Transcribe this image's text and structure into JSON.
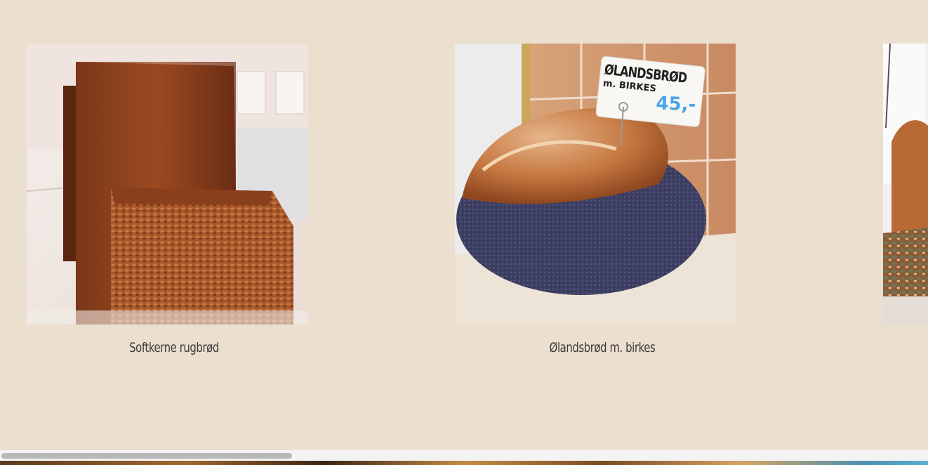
{
  "gallery": {
    "items": [
      {
        "caption": "Softkerne rugbrød",
        "image": "rye-bread-loaf-photo"
      },
      {
        "caption": "Ølandsbrød m. birkes",
        "image": "poppy-seed-bread-photo",
        "sign": {
          "line1": "ØLANDSBRØD",
          "line2": "m. BIRKES",
          "price": "45,-"
        }
      },
      {
        "caption": "",
        "image": "seeded-bread-photo-partial"
      }
    ]
  },
  "scrollbar": {
    "thumb_fraction": 0.31
  },
  "colors": {
    "background": "#ebdfd0",
    "caption_text": "#3f3a36",
    "price_tag": "#4aa3e8"
  }
}
